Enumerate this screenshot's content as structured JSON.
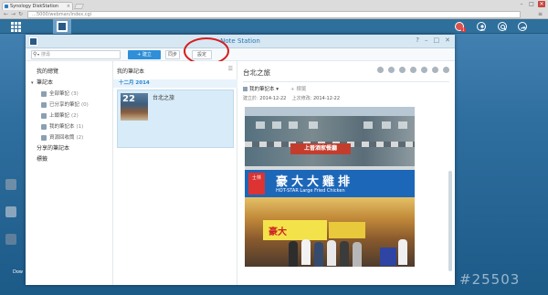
{
  "browser": {
    "tab_title": "Synology DiskStation",
    "url": "…5000/webman/index.cgi",
    "controls": [
      "–",
      "□",
      "✕"
    ]
  },
  "taskbar": {
    "badge": "1"
  },
  "desktop": {
    "labels": [
      "Dow"
    ]
  },
  "window": {
    "title": "Note Station",
    "controls": [
      "?",
      "–",
      "□",
      "✕"
    ]
  },
  "toolbar": {
    "search_placeholder": "搜尋",
    "create_label": "+ 建立",
    "sync_label": "同步",
    "settings_label": "設定"
  },
  "sidebar": {
    "items": [
      {
        "label": "我的總覽",
        "count": ""
      },
      {
        "label": "筆記本",
        "count": ""
      },
      {
        "label": "全部筆記",
        "count": "(3)"
      },
      {
        "label": "已分享的筆記",
        "count": "(0)"
      },
      {
        "label": "上鎖筆記",
        "count": "(2)"
      },
      {
        "label": "我的筆記本",
        "count": "(1)"
      },
      {
        "label": "資源回收筒",
        "count": "(2)"
      },
      {
        "label": "分享的筆記本",
        "count": ""
      },
      {
        "label": "標籤",
        "count": ""
      }
    ]
  },
  "notelist": {
    "header": "我的筆記本",
    "sort_icon": "☰",
    "month_group": "十二月 2014",
    "notes": [
      {
        "title": "台北之旅",
        "thumb_day": "22"
      }
    ]
  },
  "viewer": {
    "title": "台北之旅",
    "notebook": "我的筆記本",
    "tag_label": "+ 標籤",
    "created_label": "建立於:",
    "created_date": "2014-12-22",
    "modified_label": "上次修改:",
    "modified_date": "2014-12-22"
  },
  "photo": {
    "red_sign": "上晉酒家餐廳",
    "blue_sign_big": "豪大大雞排",
    "blue_sign_small": "HOT-STAR  Large  Fried  Chicken",
    "red_box": "士林",
    "shop_sign": "豪大"
  },
  "watermark": "#25503",
  "colors": {
    "accent": "#2f8fd8",
    "title_text": "#2a76b0",
    "highlight_circle": "#d61e1e",
    "month_text": "#2a86cf"
  }
}
